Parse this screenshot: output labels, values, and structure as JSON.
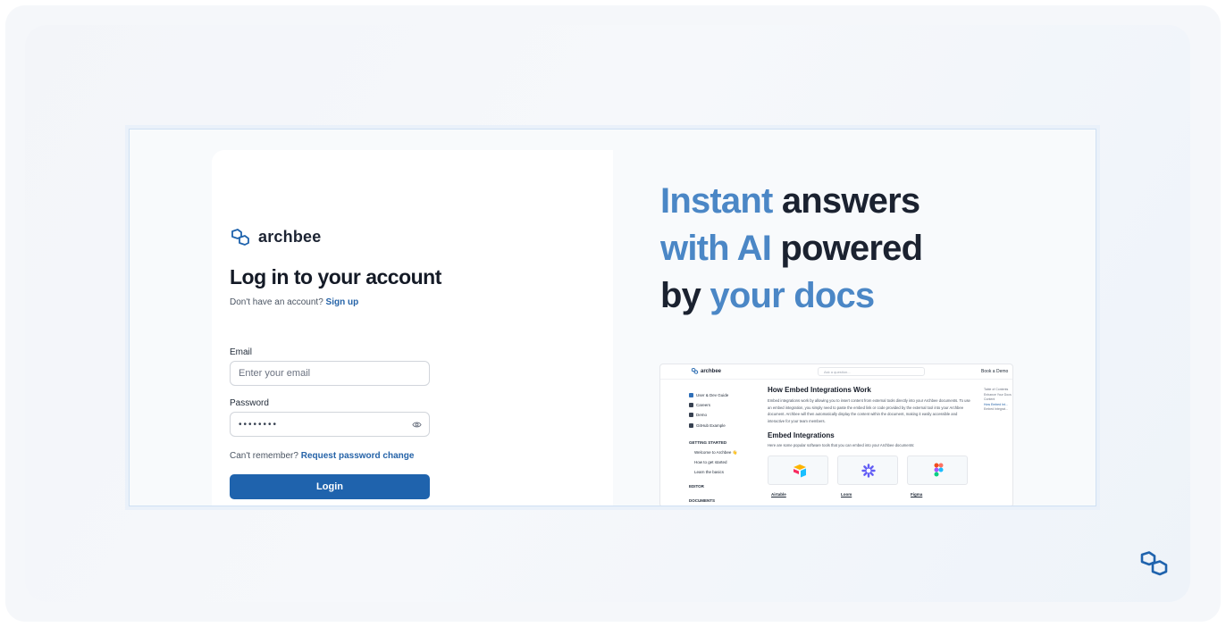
{
  "brand": {
    "name": "archbee",
    "accent": "#1f63ad",
    "highlight": "#4b87c6",
    "logo_icon": "archbee-logo-icon"
  },
  "login": {
    "title": "Log in to your account",
    "signup_prompt": "Don't have an account?",
    "signup_link": "Sign up",
    "email_label": "Email",
    "email_placeholder": "Enter your email",
    "password_label": "Password",
    "password_value": "••••••••",
    "password_icon": "eye-icon",
    "forgot_prompt": "Can't remember?",
    "forgot_link": "Request password change",
    "login_button": "Login"
  },
  "headline": {
    "part1_highlight": "Instant",
    "part1_rest": " answers",
    "part2_highlight": "with AI",
    "part2_rest": " powered",
    "part3_rest": "by ",
    "part3_highlight": "your docs"
  },
  "preview": {
    "logo": "archbee",
    "search_placeholder": "Ask a question...",
    "book_demo": "Book a Demo",
    "sidebar": [
      {
        "label": "User & Dev Guide",
        "icon": "book-icon"
      },
      {
        "label": "Careers",
        "icon": "briefcase-icon"
      },
      {
        "label": "Demo",
        "icon": "play-icon"
      },
      {
        "label": "GitHub Example",
        "icon": "github-icon"
      }
    ],
    "section_getting_started": "GETTING STARTED",
    "getting_started_items": [
      "Welcome to Archbee 👋",
      "How to get started",
      "Learn the basics"
    ],
    "section_editor": "EDITOR",
    "section_documents": "DOCUMENTS",
    "main_title": "How Embed Integrations Work",
    "main_paragraph": "Embed integrations work by allowing you to insert content from external tools directly into your Archbee documents. To use an embed integration, you simply need to paste the embed link or code provided by the external tool into your Archbee document. Archbee will then automatically display the content within the document, making it easily accessible and interactive for your team members.",
    "sub_title": "Embed Integrations",
    "sub_paragraph": "Here are some popular software tools that you can embed into your Archbee documents:",
    "cards": [
      {
        "label": "Airtable",
        "icon": "airtable-icon"
      },
      {
        "label": "Loom",
        "icon": "loom-icon"
      },
      {
        "label": "Figma",
        "icon": "figma-icon"
      }
    ],
    "toc": [
      "Table of Contents",
      "Enhance Your Docs",
      "Content",
      "How Embed Int...",
      "Embed Integrat..."
    ]
  }
}
